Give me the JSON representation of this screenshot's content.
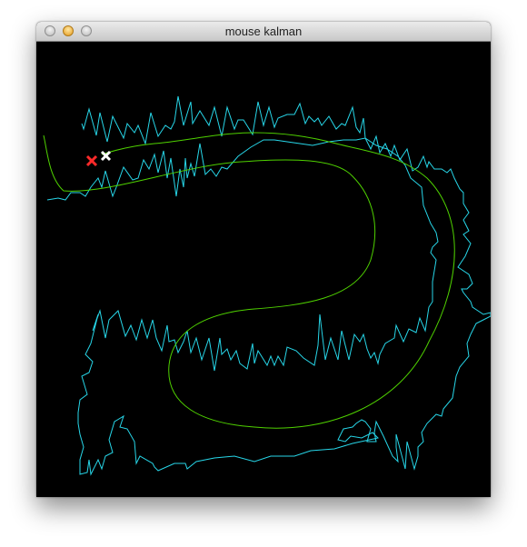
{
  "window": {
    "title": "mouse kalman"
  },
  "plot": {
    "background": "#000000",
    "measured_color": "#27d6e8",
    "kalman_color": "#4fd100",
    "current_measurement_marker_color": "#ff2a2a",
    "current_estimate_marker_color": "#ffffff"
  },
  "icons": {
    "close": "close-button",
    "minimize": "minimize-button",
    "zoom": "zoom-button"
  }
}
